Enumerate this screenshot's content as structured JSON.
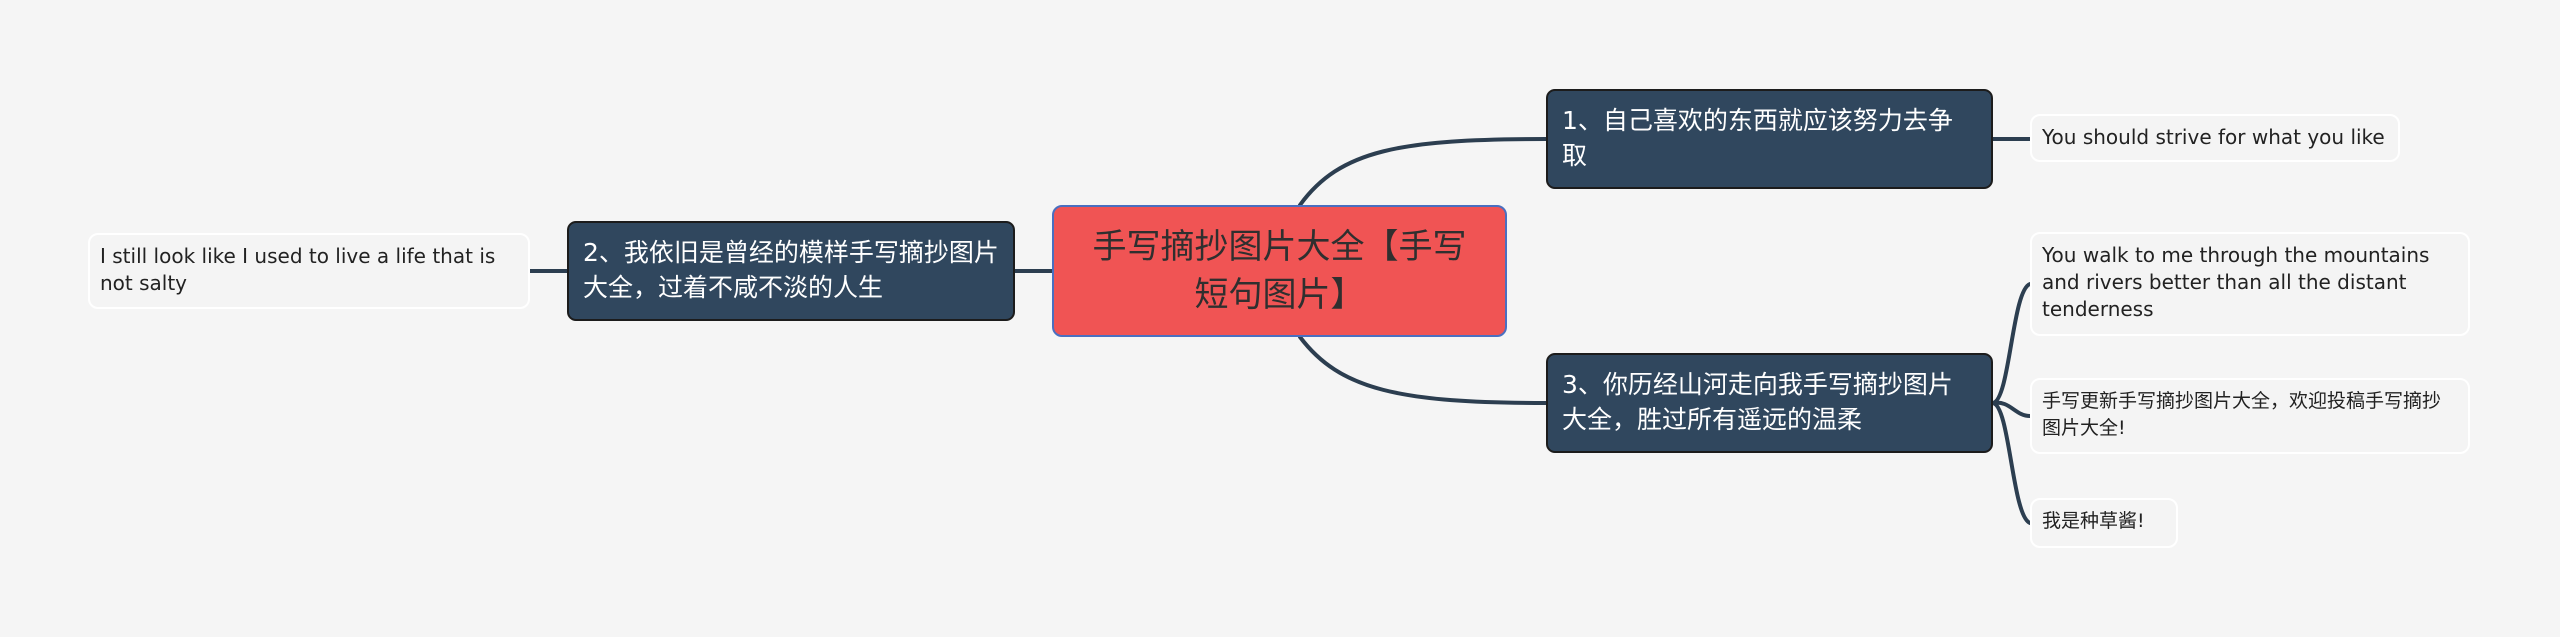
{
  "mindmap": {
    "root": {
      "label": "手写摘抄图片大全【手写短句图片】",
      "color": "#f05454",
      "border_color": "#4a6fc0"
    },
    "branches": [
      {
        "label": "1、自己喜欢的东西就应该努力去争取",
        "side": "right",
        "children": [
          {
            "label": "You should strive for what you like"
          }
        ]
      },
      {
        "label": "2、我依旧是曾经的模样手写摘抄图片大全，过着不咸不淡的人生",
        "side": "left",
        "children": [
          {
            "label": "I still look like I used to live a life that is not salty"
          }
        ]
      },
      {
        "label": "3、你历经山河走向我手写摘抄图片大全，胜过所有遥远的温柔",
        "side": "right",
        "children": [
          {
            "label": "You walk to me through the mountains and rivers better than all the distant tenderness"
          },
          {
            "label": "手写更新手写摘抄图片大全，欢迎投稿手写摘抄图片大全!"
          },
          {
            "label": "我是种草酱!"
          }
        ]
      }
    ],
    "colors": {
      "branch_fill": "#30475e",
      "connector": "#2c3e50",
      "background": "#f5f5f5",
      "leaf_fill": "#f4f4f4"
    }
  }
}
